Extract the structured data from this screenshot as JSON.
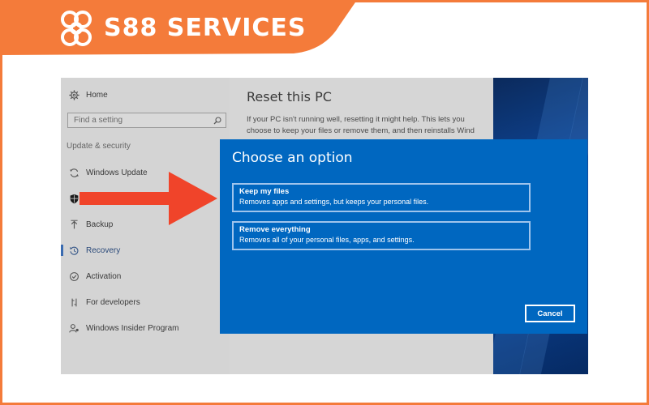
{
  "brand": {
    "name": "S88 SERVICES",
    "accent": "#f47b3a"
  },
  "settings": {
    "nav": {
      "home": "Home",
      "search_placeholder": "Find a setting",
      "section": "Update & security",
      "items": [
        {
          "label": "Windows Update",
          "icon": "sync-icon"
        },
        {
          "label": "",
          "icon": "shield-icon"
        },
        {
          "label": "Backup",
          "icon": "backup-icon"
        },
        {
          "label": "Recovery",
          "icon": "recovery-icon"
        },
        {
          "label": "Activation",
          "icon": "activation-icon"
        },
        {
          "label": "For developers",
          "icon": "developer-icon"
        },
        {
          "label": "Windows Insider Program",
          "icon": "insider-icon"
        }
      ],
      "active": "Recovery"
    },
    "main": {
      "title": "Reset this PC",
      "description": "If your PC isn't running well, resetting it might help. This lets you choose to keep your files or remove them, and then reinstalls Wind"
    }
  },
  "dialog": {
    "title": "Choose an option",
    "options": [
      {
        "title": "Keep my files",
        "desc": "Removes apps and settings, but keeps your personal files."
      },
      {
        "title": "Remove everything",
        "desc": "Removes all of your personal files, apps, and settings."
      }
    ],
    "cancel": "Cancel",
    "bg_color": "#0067c0"
  },
  "annotation": {
    "arrow_color": "#f0442a",
    "icon": "red-arrow"
  }
}
